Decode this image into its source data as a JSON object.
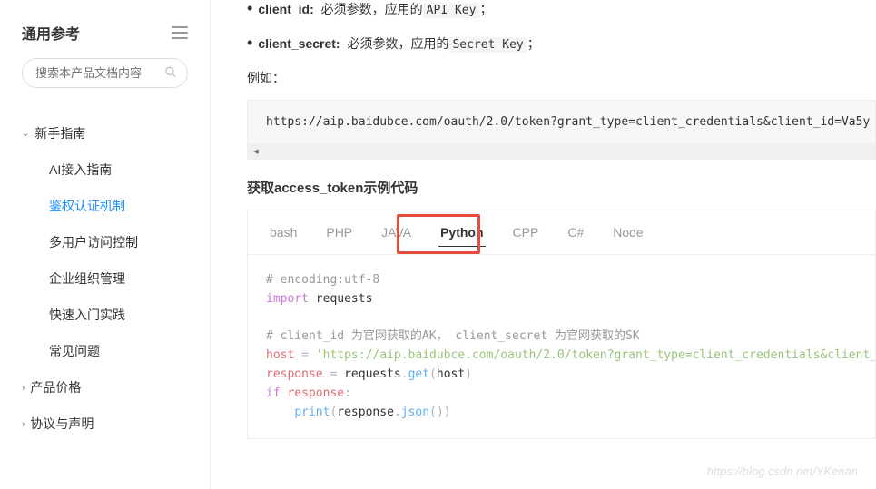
{
  "sidebar": {
    "title": "通用参考",
    "search_placeholder": "搜索本产品文档内容",
    "sections": [
      {
        "label": "新手指南",
        "expanded": true,
        "items": [
          {
            "label": "AI接入指南",
            "active": false
          },
          {
            "label": "鉴权认证机制",
            "active": true
          },
          {
            "label": "多用户访问控制",
            "active": false
          },
          {
            "label": "企业组织管理",
            "active": false
          },
          {
            "label": "快速入门实践",
            "active": false
          },
          {
            "label": "常见问题",
            "active": false
          }
        ]
      },
      {
        "label": "产品价格",
        "expanded": false
      },
      {
        "label": "协议与声明",
        "expanded": false
      }
    ]
  },
  "params": [
    {
      "name": "client_id:",
      "desc_before": "必须参数，应用的",
      "code": "API Key",
      "desc_after": "；"
    },
    {
      "name": "client_secret:",
      "desc_before": "必须参数，应用的",
      "code": "Secret Key",
      "desc_after": "；"
    }
  ],
  "example_label": "例如：",
  "example_url": "https://aip.baidubce.com/oauth/2.0/token?grant_type=client_credentials&client_id=Va5y",
  "section_heading": "获取access_token示例代码",
  "tabs": [
    "bash",
    "PHP",
    "JAVA",
    "Python",
    "CPP",
    "C#",
    "Node"
  ],
  "active_tab": "Python",
  "code": {
    "l1": "# encoding:utf-8",
    "l2_kw": "import",
    "l2_mod": "requests",
    "l3": "# client_id 为官网获取的AK， client_secret 为官网获取的SK",
    "l4_var": "host",
    "l4_str": "'https://aip.baidubce.com/oauth/2.0/token?grant_type=client_credentials&client_",
    "l5_var": "response",
    "l5_mod": "requests",
    "l5_func": "get",
    "l5_arg": "host",
    "l6_kw": "if",
    "l6_var": "response",
    "l7_func": "print",
    "l7_obj": "response",
    "l7_meth": "json"
  },
  "watermark": "https://blog.csdn.net/YKenan"
}
